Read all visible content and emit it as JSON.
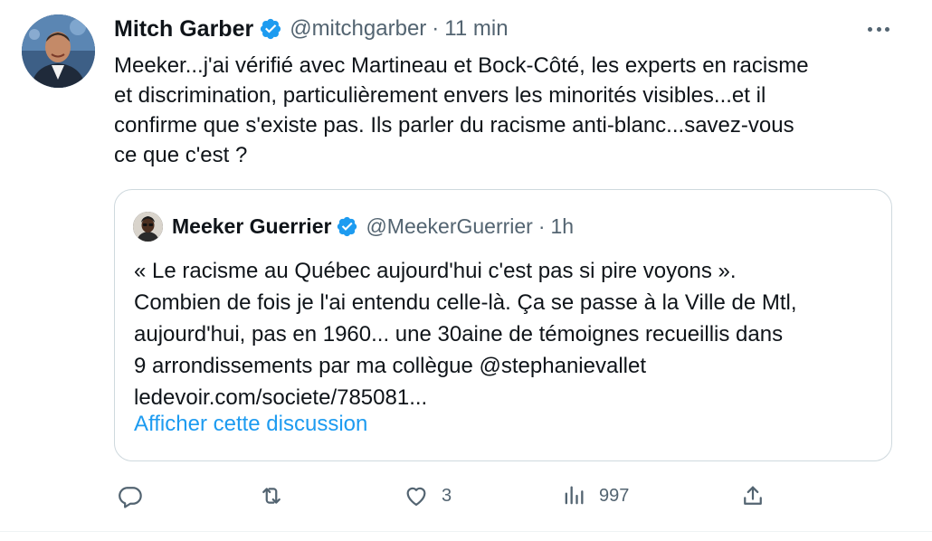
{
  "tweet": {
    "author": {
      "display_name": "Mitch Garber",
      "handle": "@mitchgarber",
      "verified": true,
      "avatar_icon": "profile-photo"
    },
    "separator": "·",
    "time": "11 min",
    "more_icon": "more-horizontal-icon",
    "text": "Meeker...j'ai vérifié avec Martineau et Bock-Côté, les experts en racisme\net discrimination, particulièrement envers les minorités visibles...et il\nconfirme que s'existe pas. Ils parler du racisme anti-blanc...savez-vous\nce que c'est ?",
    "quote": {
      "author": {
        "display_name": "Meeker Guerrier",
        "handle": "@MeekerGuerrier",
        "verified": true,
        "avatar_icon": "profile-photo"
      },
      "separator": "·",
      "time": "1h",
      "text": "« Le racisme au Québec aujourd'hui c'est pas si pire voyons ».\nCombien de fois je l'ai entendu celle-là. Ça se passe  à la Ville de Mtl,\naujourd'hui, pas en 1960... une 30aine de témoignes recueillis dans\n9 arrondissements par ma collègue @stephanievallet\nledevoir.com/societe/785081...",
      "show_thread_label": "Afficher cette discussion"
    },
    "actions": {
      "reply": {
        "icon": "reply-icon",
        "count": ""
      },
      "retweet": {
        "icon": "retweet-icon",
        "count": ""
      },
      "like": {
        "icon": "heart-icon",
        "count": "3"
      },
      "views": {
        "icon": "views-icon",
        "count": "997"
      },
      "share": {
        "icon": "share-icon",
        "count": ""
      }
    }
  },
  "colors": {
    "text_primary": "#0f1419",
    "text_secondary": "#536471",
    "accent": "#1d9bf0",
    "border": "#cfd9de"
  }
}
